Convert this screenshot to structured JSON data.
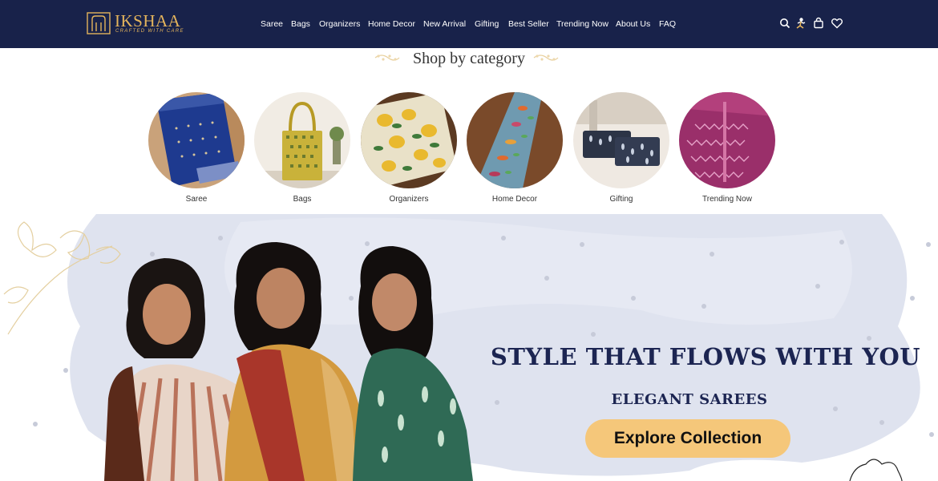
{
  "brand": {
    "name": "IKSHAA",
    "tagline": "CRAFTED WITH CARE",
    "accent_color": "#e4b45c",
    "header_color": "#18224a"
  },
  "nav": {
    "items": [
      {
        "label": "Saree"
      },
      {
        "label": "Bags"
      },
      {
        "label": "Organizers"
      },
      {
        "label": "Home Decor"
      },
      {
        "label": "New Arrival"
      },
      {
        "label": "Gifting"
      },
      {
        "label": "Best Seller"
      },
      {
        "label": "Trending Now"
      },
      {
        "label": "About Us"
      },
      {
        "label": "FAQ"
      }
    ]
  },
  "header_icons": [
    "search-icon",
    "account-icon",
    "cart-icon",
    "wishlist-icon"
  ],
  "categories_section": {
    "title": "Shop by category",
    "items": [
      {
        "label": "Saree",
        "image": "blue-saree-image"
      },
      {
        "label": "Bags",
        "image": "yellow-tote-bag-image"
      },
      {
        "label": "Organizers",
        "image": "lemon-print-organizer-image"
      },
      {
        "label": "Home Decor",
        "image": "table-runner-image"
      },
      {
        "label": "Gifting",
        "image": "pouch-set-image"
      },
      {
        "label": "Trending Now",
        "image": "magenta-saree-image"
      }
    ]
  },
  "hero": {
    "headline": "STYLE THAT FLOWS WITH YOU",
    "subheadline": "ELEGANT SAREES",
    "cta_label": "Explore Collection",
    "cta_color": "#f5c77a",
    "text_color": "#1c2552"
  }
}
